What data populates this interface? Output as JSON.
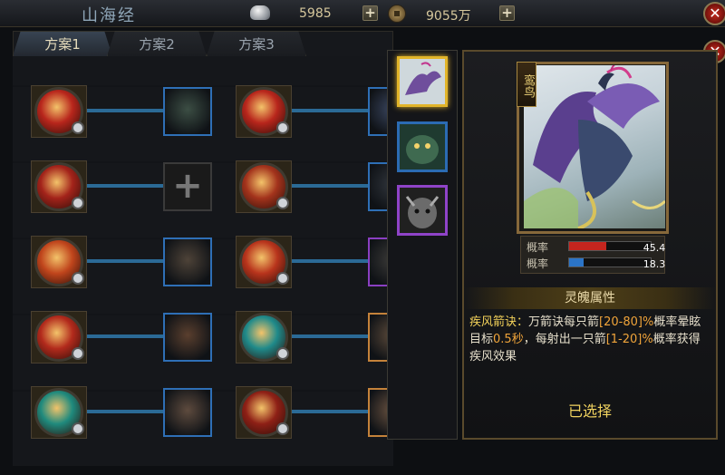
{
  "header": {
    "title": "山海经",
    "silver": "5985",
    "gold": "9055万",
    "plus": "+",
    "close": "✕"
  },
  "tabs": [
    {
      "label": "方案1",
      "active": true
    },
    {
      "label": "方案2",
      "active": false
    },
    {
      "label": "方案3",
      "active": false
    }
  ],
  "slots_left": [
    {
      "skill_color": "#b8261c",
      "beast_border": "blue",
      "beast_color": "#3c4e44"
    },
    {
      "skill_color": "#a3231a",
      "beast_border": "empty",
      "beast_symbol": "+"
    },
    {
      "skill_color": "#c0451c",
      "beast_border": "blue",
      "beast_color": "#4e4338"
    },
    {
      "skill_color": "#b22a1c",
      "beast_border": "blue",
      "beast_color": "#5a3f2e"
    },
    {
      "skill_color": "#1f8a7d",
      "beast_border": "blue",
      "beast_color": "#5e4b3e"
    }
  ],
  "slots_right": [
    {
      "skill_color": "#b8261c",
      "beast_border": "blue",
      "beast_color": "#3a4660"
    },
    {
      "skill_color": "#a3331c",
      "beast_border": "blue",
      "beast_color": "#30353c"
    },
    {
      "skill_color": "#b8341c",
      "beast_border": "purple",
      "beast_color": "#3b3a38"
    },
    {
      "skill_color": "#1f8a8a",
      "beast_border": "orange",
      "beast_color": "#5c4a3a"
    },
    {
      "skill_color": "#8e2016",
      "beast_border": "orange",
      "beast_color": "#6a5240"
    }
  ],
  "mid_cards": [
    {
      "id": "luan-bird",
      "border": "selected",
      "color": "#8b6ab8"
    },
    {
      "id": "beast-2",
      "border": "blue",
      "color": "#2f5a4a"
    },
    {
      "id": "beast-3",
      "border": "purple",
      "color": "#3c3c3c"
    }
  ],
  "detail": {
    "name": "鸾鸟",
    "stats": [
      {
        "label": "概率",
        "value": "45.4",
        "fraction": 0.454,
        "color": "#c4251e"
      },
      {
        "label": "概率",
        "value": "18.3",
        "fraction": 0.183,
        "color": "#2b74c7"
      }
    ],
    "attr_title": "灵魄属性",
    "skill_name": "疾风箭诀：",
    "desc_1": "万箭诀每只箭",
    "range_1": "[20-80]%",
    "desc_2": "概率晕眩目标",
    "dur": "0.5秒",
    "desc_3": "，每射出一只箭",
    "range_2": "[1-20]%",
    "desc_4": "概率获得疾风效果",
    "chosen": "已选择"
  }
}
